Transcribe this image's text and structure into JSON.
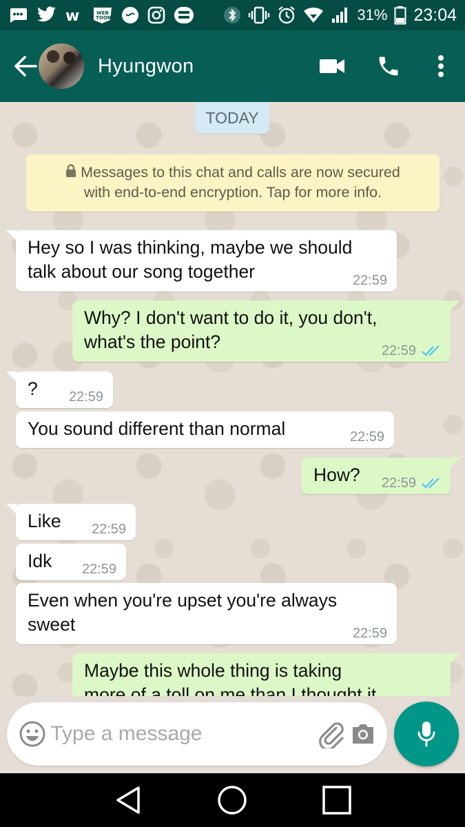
{
  "status_bar": {
    "battery": "31%",
    "time": "23:04",
    "icons": [
      "sms-icon",
      "twitter-icon",
      "webtoon-w-icon",
      "webtoon-icon",
      "chat-bubble-icon",
      "instagram-icon",
      "app-icon",
      "bluetooth-icon",
      "vibrate-icon",
      "alarm-icon",
      "wifi-icon",
      "signal-icon",
      "battery-icon"
    ]
  },
  "header": {
    "contact_name": "Hyungwon",
    "icons": [
      "back-arrow-icon",
      "video-call-icon",
      "phone-icon",
      "more-vert-icon"
    ]
  },
  "chat": {
    "date_chip": "TODAY",
    "encryption_notice_line1": "Messages to this chat and calls are now secured",
    "encryption_notice_line2": "with end-to-end encryption. Tap for more info.",
    "messages": [
      {
        "direction": "in",
        "text_line1": "Hey so I was thinking, maybe we should",
        "text_line2": "talk about our song together",
        "time": "22:59"
      },
      {
        "direction": "out",
        "text_line1": "Why? I don't want to do it, you don't,",
        "text_line2": "what's the point?",
        "time": "22:59",
        "status": "read"
      },
      {
        "direction": "in",
        "text": "?",
        "time": "22:59"
      },
      {
        "direction": "in",
        "text": "You sound different than normal",
        "time": "22:59"
      },
      {
        "direction": "out",
        "text": "How?",
        "time": "22:59",
        "status": "read"
      },
      {
        "direction": "in",
        "text": "Like",
        "time": "22:59"
      },
      {
        "direction": "in",
        "text": "Idk",
        "time": "22:59"
      },
      {
        "direction": "in",
        "text_line1": "Even when you're upset you're always",
        "text_line2": "sweet",
        "time": "22:59"
      },
      {
        "direction": "out",
        "text_line1": "Maybe this whole thing is taking",
        "text_line2": "more of a toll on me than I thought it"
      }
    ]
  },
  "input": {
    "placeholder": "Type a message",
    "value": ""
  },
  "colors": {
    "header": "#075e54",
    "status_bar": "#054d44",
    "outgoing_bubble": "#dcf8c6",
    "incoming_bubble": "#ffffff",
    "read_ticks": "#4fc3f7",
    "mic_button": "#009688",
    "encryption_notice": "#fcf4c4",
    "date_chip": "#d4eaf4"
  }
}
